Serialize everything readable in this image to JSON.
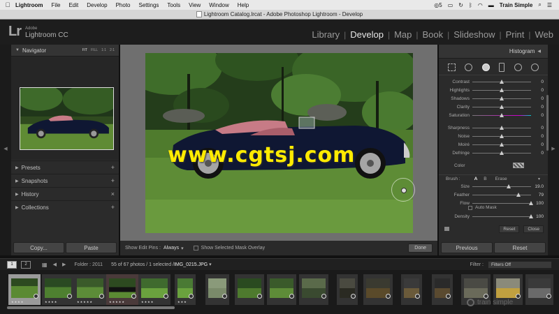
{
  "menubar": {
    "app": "Lightroom",
    "items": [
      "File",
      "Edit",
      "Develop",
      "Photo",
      "Settings",
      "Tools",
      "View",
      "Window",
      "Help"
    ],
    "badge": "5",
    "user": "Train Simple"
  },
  "window_title": "Lightroom Catalog.lrcat - Adobe Photoshop Lightroom - Develop",
  "identity": {
    "adobe": "Adobe",
    "product": "Lightroom CC",
    "mark": "Lr"
  },
  "modules": [
    "Library",
    "Develop",
    "Map",
    "Book",
    "Slideshow",
    "Print",
    "Web"
  ],
  "active_module": "Develop",
  "left_panel": {
    "navigator": "Navigator",
    "zoom": [
      "FIT",
      "FILL",
      "1:1",
      "2:1"
    ],
    "panels": [
      {
        "label": "Presets",
        "action": "+"
      },
      {
        "label": "Snapshots",
        "action": "+"
      },
      {
        "label": "History",
        "action": "×"
      },
      {
        "label": "Collections",
        "action": "+"
      }
    ],
    "copy_button": "Copy...",
    "paste_button": "Paste"
  },
  "toolbar": {
    "pins_label": "Show Edit Pins :",
    "pins_value": "Always",
    "overlay_label": "Show Selected Mask Overlay",
    "done": "Done"
  },
  "watermark": "www.cgtsj.com",
  "right_panel": {
    "histogram": "Histogram",
    "group1": [
      {
        "label": "Contrast",
        "value": "0",
        "pos": 0.5
      },
      {
        "label": "Highlights",
        "value": "0",
        "pos": 0.5
      },
      {
        "label": "Shadows",
        "value": "0",
        "pos": 0.5
      },
      {
        "label": "Clarity",
        "value": "0",
        "pos": 0.5
      },
      {
        "label": "Saturation",
        "value": "0",
        "pos": 0.5
      }
    ],
    "group2": [
      {
        "label": "Sharpness",
        "value": "0",
        "pos": 0.5
      },
      {
        "label": "Noise",
        "value": "0",
        "pos": 0.5
      },
      {
        "label": "Moiré",
        "value": "0",
        "pos": 0.5
      },
      {
        "label": "Defringe",
        "value": "0",
        "pos": 0.5
      }
    ],
    "color_label": "Color",
    "brush_label": "Brush :",
    "brush_a": "A",
    "brush_b": "B",
    "erase": "Erase",
    "group3": [
      {
        "label": "Size",
        "value": "19.0",
        "pos": 0.62
      },
      {
        "label": "Feather",
        "value": "79",
        "pos": 0.79
      },
      {
        "label": "Flow",
        "value": "100",
        "pos": 1.0
      }
    ],
    "auto_mask": "Auto Mask",
    "group4": [
      {
        "label": "Density",
        "value": "100",
        "pos": 1.0
      }
    ],
    "reset_small": "Reset",
    "close_small": "Close",
    "previous_button": "Previous",
    "reset_button": "Reset"
  },
  "filmstrip_bar": {
    "screen1": "1",
    "screen2": "2",
    "folder": "Folder : 2011",
    "count_prefix": "55 of 67 photos / 1 selected /",
    "filename": "IMG_0215.JPG",
    "filter_label": "Filter :",
    "filter_value": "Filters Off"
  },
  "brand_watermark": "train simple",
  "colors": {
    "accent_yellow": "#ffeb00",
    "panel_bg": "#2b2b2b",
    "car_body": "#0f1733",
    "car_interior": "#c77b86"
  }
}
